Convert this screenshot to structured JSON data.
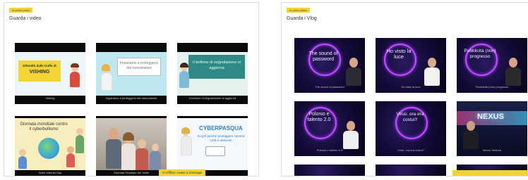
{
  "panels": [
    {
      "tag": "In primo piano",
      "title": "Guarda i video",
      "tiles": [
        {
          "caption": "Vishing",
          "overlay": "Difenditi dalle truffe di",
          "overlay2": "VISHING"
        },
        {
          "caption": "Impariamo a proteggerci dal ransomware",
          "overlay": "Impariamo a proteggerci dal ransomware"
        },
        {
          "caption": "Il bottone di segnalazione si aggiorna",
          "overlay": "Il bottone di segnalazione si aggiorna"
        },
        {
          "caption": "Safer Internet Day",
          "overlay": "Giornata mondiale contro il cyberbullismo"
        },
        {
          "caption": "Giornata Mondiale dei Selfie",
          "overlay": ""
        },
        {
          "caption": "",
          "overlay": "CYBERPASQUA",
          "overlay2": "Scopri perché proteggere camera USB e webcam"
        }
      ],
      "toast": "Offline: Leave a message"
    },
    {
      "tag": "In primo piano",
      "title": "Guarda i Vlog",
      "tiles": [
        {
          "caption": "The sound of password",
          "overlay": "The sound of password"
        },
        {
          "caption": "Ho visto la luce",
          "overlay": "Ho visto la luce"
        },
        {
          "caption": "Pubblicità (non) progresso",
          "overlay": "Pubblicità (non) progresso"
        },
        {
          "caption": "Polonio e talento 2.0",
          "overlay": "Polonio e talento 2.0"
        },
        {
          "caption": "Virus: ora era costui?",
          "overlay": "Virus: ora era costui?"
        },
        {
          "caption": "Nexus Ventura",
          "overlay": "NEXUS"
        }
      ]
    }
  ],
  "colors": {
    "accent_yellow": "#f2d23b",
    "vlog_ring": "#c54bff",
    "panel_border": "#dedede"
  },
  "icons": {
    "chat": "chat-bubble-icon"
  }
}
